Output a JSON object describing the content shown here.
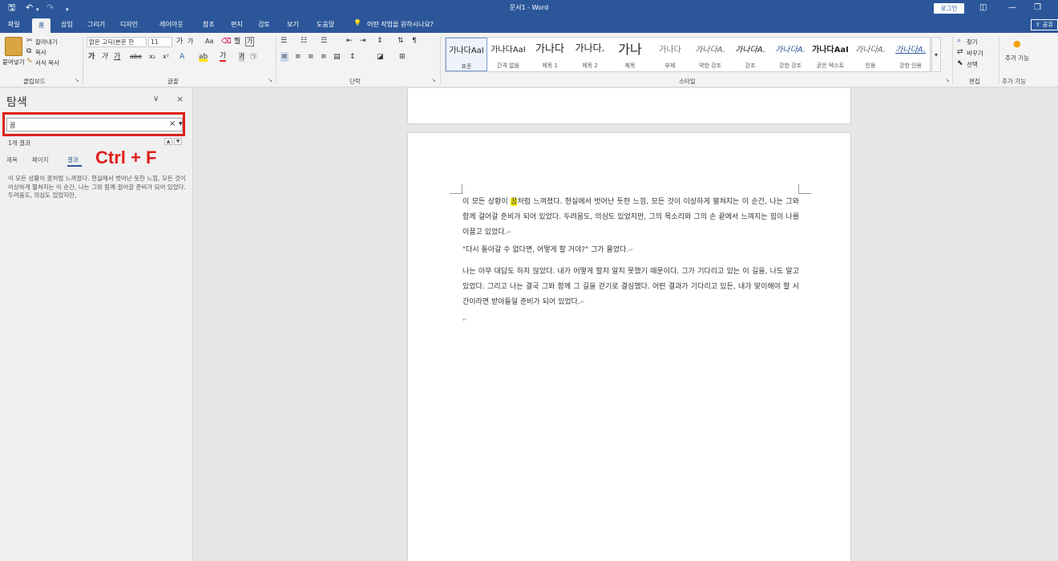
{
  "title_bar": {
    "save_icon": "save-icon",
    "undo_icon": "undo-icon",
    "redo_icon": "redo-icon",
    "doc_title": "문서1 - Word",
    "login_label": "로그인",
    "colors": {
      "background": "#2b579a"
    }
  },
  "tabs": [
    {
      "label": "파일"
    },
    {
      "label": "홈"
    },
    {
      "label": "삽입"
    },
    {
      "label": "그리기"
    },
    {
      "label": "디자인"
    },
    {
      "label": "레이아웃"
    },
    {
      "label": "참조"
    },
    {
      "label": "편지"
    },
    {
      "label": "검토"
    },
    {
      "label": "보기"
    },
    {
      "label": "도움말"
    }
  ],
  "tell_me": "어떤 작업을 원하시나요?",
  "share_label": "공유",
  "ribbon": {
    "clipboard": {
      "paste_label": "붙여넣기",
      "cut_label": "잘라내기",
      "copy_label": "복사",
      "format_painter_label": "서식 복사",
      "group_label": "클립보드"
    },
    "font": {
      "font_name": "맑은 고딕(본문 한",
      "font_size": "11",
      "group_label": "글꼴"
    },
    "paragraph": {
      "group_label": "단락"
    },
    "styles": {
      "group_label": "스타일",
      "items": [
        {
          "sample": "가나다AaI",
          "name": "표준"
        },
        {
          "sample": "가나다AaI",
          "name": "간격 없음"
        },
        {
          "sample": "가나다",
          "name": "제목 1"
        },
        {
          "sample": "가나다.",
          "name": "제목 2"
        },
        {
          "sample": "가나",
          "name": "제목"
        },
        {
          "sample": "가나다",
          "name": "부제"
        },
        {
          "sample": "가나다A.",
          "name": "약한 강조"
        },
        {
          "sample": "가나다A.",
          "name": "강조"
        },
        {
          "sample": "가나다A.",
          "name": "강한 강조"
        },
        {
          "sample": "가나다AaI",
          "name": "굵은 텍스트"
        },
        {
          "sample": "가나다A.",
          "name": "인용"
        },
        {
          "sample": "가나다A.",
          "name": "강한 인용"
        }
      ]
    },
    "editing": {
      "find_label": "찾기",
      "replace_label": "바꾸기",
      "select_label": "선택",
      "group_label": "편집"
    },
    "addins": {
      "label": "추가 기능",
      "group_label": "추가 기능"
    }
  },
  "nav_pane": {
    "title": "탐색",
    "search_value": "꿈",
    "result_count": "1개 결과",
    "tabs": [
      {
        "label": "제목"
      },
      {
        "label": "페이지"
      },
      {
        "label": "결과"
      }
    ],
    "shortcut_label": "Ctrl + F",
    "result_snippet": "이 모든 상황이 꿈처럼 느껴졌다. 현실에서 벗어난 듯한 느낌, 모든 것이 이상하게 펼쳐지는 이 순간, 나는 그와 함께 걸어갈 준비가 되어 있었다. 두려움도, 의심도 있었지만,"
  },
  "document": {
    "paragraph1_before": "이 모든 상황이 ",
    "paragraph1_highlight": "꿈",
    "paragraph1_after": "처럼 느껴졌다. 현실에서 벗어난 듯한 느낌, 모든 것이 이상하게 펼쳐지는 이 순간, 나는 그와 함께 걸어갈 준비가 되어 있었다. 두려움도, 의심도 있었지만, 그의 목소리와 그의 손 끝에서 느껴지는 힘이 나를 이끌고 있었다.",
    "paragraph2": "\"다시 돌아갈 수 없다면, 어떻게 할 거야?\" 그가 물었다.",
    "paragraph3": "나는 아무 대답도 하지 않았다. 내가 어떻게 할지 알지 못했기 때문이다. 그가 기다리고 있는 이 길을, 나도 알고 있었다. 그리고 나는 결국 그와 함께 그 길을 걷기로 결심했다. 어떤 결과가 기다리고 있든, 내가 맞이해야 할 시간이라면 받아들일 준비가 되어 있었다.",
    "para_mark": "↵",
    "highlight_color": "#fff200"
  }
}
